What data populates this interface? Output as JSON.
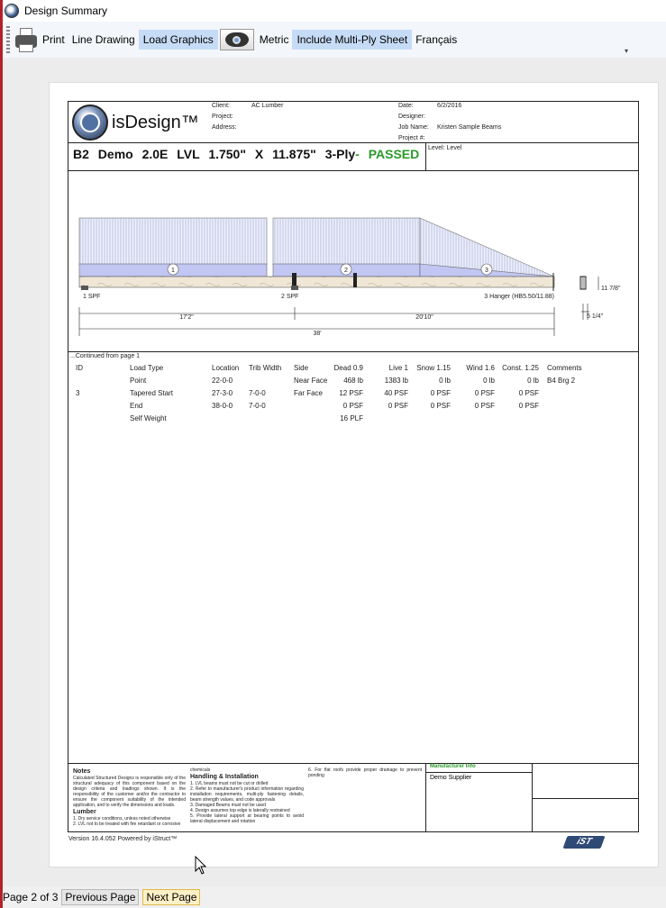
{
  "window": {
    "title": "Design Summary"
  },
  "toolbar": {
    "print": "Print",
    "line_drawing": "Line Drawing",
    "load_graphics": "Load Graphics",
    "metric": "Metric",
    "include_multiply": "Include Multi-Ply Sheet",
    "language": "Français"
  },
  "report": {
    "logo_text": "isDesign™",
    "client_label": "Client:",
    "client": "AC Lumber",
    "project_label": "Project:",
    "project": "",
    "address_label": "Address:",
    "address": "",
    "date_label": "Date:",
    "date": "6/2/2016",
    "designer_label": "Designer:",
    "designer": "",
    "job_label": "Job Name:",
    "job": "Kristen Sample Beams",
    "projnum_label": "Project #:",
    "projnum": "",
    "beam_id": "B2",
    "beam_desc": "Demo 2.0E LVL",
    "beam_size": "1.750\" X 11.875\"",
    "beam_ply": "3-Ply",
    "beam_status": "- PASSED",
    "level": "Level: Level",
    "diagram": {
      "span_labels": [
        "1",
        "2",
        "3"
      ],
      "supports": [
        "1 SPF",
        "2 SPF",
        "3 Hanger (HB5.50/11.88)"
      ],
      "dim_1": "17'2\"",
      "dim_2": "20'10\"",
      "dim_total": "38'",
      "depth": "11 7/8\"",
      "width": "5 1/4\""
    },
    "continued": "...Continued from page 1",
    "table": {
      "headers": [
        "ID",
        "Load Type",
        "Location",
        "Trib Width",
        "Side",
        "Dead 0.9",
        "Live 1",
        "Snow 1.15",
        "Wind 1.6",
        "Const. 1.25",
        "Comments"
      ],
      "rows": [
        [
          "",
          "Point",
          "22-0-0",
          "",
          "Near Face",
          "468 lb",
          "1383 lb",
          "0 lb",
          "0 lb",
          "0 lb",
          "B4 Brg 2"
        ],
        [
          "3",
          "Tapered Start",
          "27-3-0",
          "7-0-0",
          "Far Face",
          "12 PSF",
          "40 PSF",
          "0 PSF",
          "0 PSF",
          "0 PSF",
          ""
        ],
        [
          "",
          "End",
          "38-0-0",
          "7-0-0",
          "",
          "0 PSF",
          "0 PSF",
          "0 PSF",
          "0 PSF",
          "0 PSF",
          ""
        ],
        [
          "",
          "Self Weight",
          "",
          "",
          "",
          "16 PLF",
          "",
          "",
          "",
          "",
          ""
        ]
      ]
    },
    "footer": {
      "notes_title": "Notes",
      "notes_text": "Calculated Structured Designs is responsible only of the structural adequacy of this component based on the design criteria and loadings shown. It is the responsibility of the customer and/or the contractor to ensure the component suitability of the intended application, and to verify the dimensions and loads.",
      "lumber_title": "Lumber",
      "lumber_1": "1. Dry service conditions, unless noted otherwise",
      "lumber_2": "2. LVL not to be treated with fire retardant or corrosive",
      "chemicals": "chemicals",
      "handling_title": "Handling & Installation",
      "handling_1": "1. LVL beams must not be cut or drilled",
      "handling_2": "2. Refer to manufacturer's product information regarding installation requirements, multi-ply fastening details, beam strength values, and code approvals",
      "handling_3": "3. Damaged Beams must not be used",
      "handling_4": "4. Design assumes top edge is laterally restrained",
      "handling_5": "5. Provide lateral support at bearing points to avoid lateral displacement and rotation",
      "handling_6": "6. For flat roofs provide proper drainage to prevent ponding",
      "mfr_title": "Manufacturer Info",
      "mfr_value": "Demo Supplier"
    },
    "version": "Version 16.4.052 Powered by iStruct™",
    "ist_logo": "iST"
  },
  "status": {
    "page": "Page 2 of 3",
    "prev": "Previous Page",
    "next": "Next Page"
  }
}
